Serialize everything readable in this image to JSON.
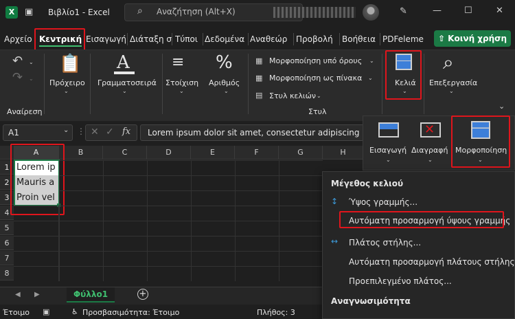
{
  "titlebar": {
    "app_logo": "X",
    "title": "Βιβλίο1 - Excel",
    "search_placeholder": "Αναζήτηση (Alt+X)"
  },
  "tabs": [
    "Αρχείο",
    "Κεντρική",
    "Εισαγωγή",
    "Διάταξη σ",
    "Τύποι",
    "Δεδομένα",
    "Αναθεώρ",
    "Προβολή",
    "Βοήθεια",
    "PDFeleme"
  ],
  "share_label": "Κοινή χρήση",
  "ribbon": {
    "undo_label": "Αναίρεση",
    "clipboard_label": "Πρόχειρο",
    "font_label": "Γραμματοσειρά",
    "alignment_label": "Στοίχιση",
    "number_label": "Αριθμός",
    "cond_format_label": "Μορφοποίηση υπό όρους",
    "format_table_label": "Μορφοποίηση ως πίνακα",
    "cell_styles_label": "Στυλ κελιών",
    "styles_group_label": "Στυλ",
    "cells_label": "Κελιά",
    "editing_label": "Επεξεργασία"
  },
  "formula_bar": {
    "name_box": "A1",
    "fx": "fx",
    "content": "Lorem ipsum dolor sit amet, consectetur adipiscing"
  },
  "grid": {
    "columns": [
      "A",
      "B",
      "C",
      "D",
      "E",
      "F",
      "G",
      "H"
    ],
    "rows": [
      "1",
      "2",
      "3",
      "4",
      "5",
      "6",
      "7",
      "8"
    ],
    "cells": [
      "Lorem ip",
      "Mauris a",
      "Proin vel"
    ]
  },
  "sheet_tab": "Φύλλο1",
  "status": {
    "ready": "Έτοιμο",
    "accessibility": "Προσβασιμότητα: Έτοιμο",
    "count": "Πλήθος: 3"
  },
  "cells_panel": {
    "insert_label": "Εισαγωγή",
    "delete_label": "Διαγραφή",
    "format_label": "Μορφοποίηση"
  },
  "format_menu": {
    "header_cell_size": "Μέγεθος κελιού",
    "row_height": "Ύψος γραμμής...",
    "autofit_row": "Αυτόματη προσαρμογή ύψους γραμμής",
    "column_width": "Πλάτος στήλης...",
    "autofit_column": "Αυτόματη προσαρμογή πλάτους στήλης",
    "default_width": "Προεπιλεγμένο πλάτος...",
    "header_visibility": "Αναγνωσιμότητα"
  },
  "colors": {
    "accent_green": "#1b7a45",
    "highlight_red": "#e0151c"
  }
}
